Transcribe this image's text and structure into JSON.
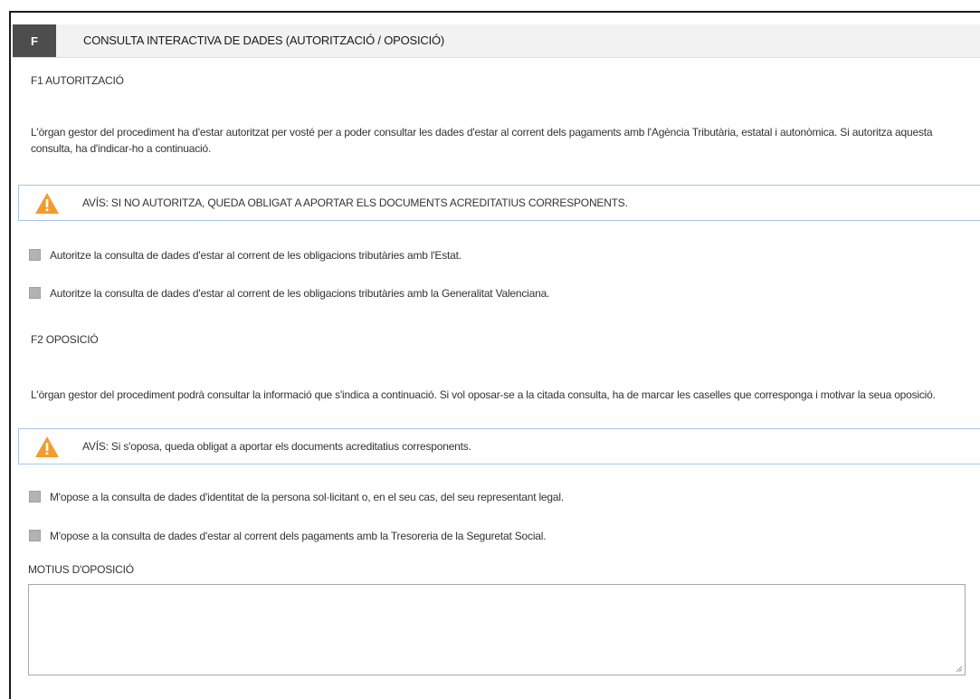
{
  "section": {
    "letter": "F",
    "title": "CONSULTA INTERACTIVA DE DADES (AUTORITZACIÓ / OPOSICIÓ)"
  },
  "f1": {
    "heading": "F1 AUTORITZACIÓ",
    "paragraph": "L'òrgan gestor del procediment ha d'estar autoritzat per vosté per a poder consultar les dades d'estar al corrent dels pagaments amb l'Agència Tributària, estatal i autonòmica. Si autoritza aquesta consulta, ha d'indicar-ho a continuació.",
    "warning": "AVÍS: SI NO AUTORITZA, QUEDA OBLIGAT A APORTAR ELS DOCUMENTS ACREDITATIUS CORRESPONENTS.",
    "checkboxes": [
      "Autoritze la consulta de dades d'estar al corrent de les obligacions tributàries amb l'Estat.",
      "Autoritze la consulta de dades d'estar al corrent de les obligacions tributàries amb la Generalitat Valenciana."
    ]
  },
  "f2": {
    "heading": "F2 OPOSICIÓ",
    "paragraph": "L'òrgan gestor del procediment podrà consultar la informació que s'indica a continuació. Si vol oposar-se a la citada consulta, ha de marcar les caselles que corresponga i motivar la seua oposició.",
    "warning": "AVÍS: Si s'oposa, queda obligat a aportar els documents acreditatius corresponents.",
    "checkboxes": [
      "M'opose a la consulta de dades d'identitat de la persona sol·licitant o, en el seu cas, del seu representant legal.",
      "M'opose a la consulta de dades d'estar al corrent dels pagaments amb la Tresoreria de la Seguretat Social."
    ]
  },
  "motius": {
    "label": "MOTIUS D'OPOSICIÓ",
    "value": ""
  },
  "colors": {
    "header_bg": "#f2f2f2",
    "letter_bg": "#4d4d4d",
    "warning_border": "#a9c6e4",
    "warning_icon": "#f39c2b",
    "checkbox": "#b3b3b3"
  }
}
